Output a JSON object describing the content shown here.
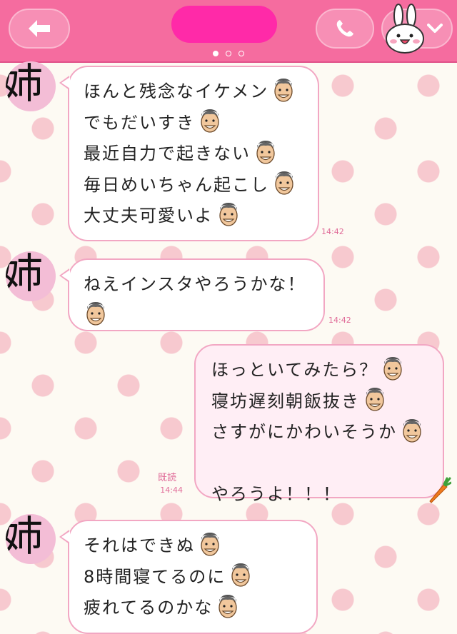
{
  "header": {
    "back_icon": "back-arrow-icon",
    "call_icon": "phone-icon",
    "profile_icon": "bunny-face-icon",
    "dropdown_icon": "chevron-down-icon",
    "page_dots": 3,
    "active_dot": 0,
    "colors": {
      "bar": "#f56c9f",
      "button": "#f78fb5",
      "redaction": "#ff2aa8"
    }
  },
  "messages": [
    {
      "sender": "other",
      "avatar_text": "姉",
      "lines": [
        "ほんと残念なイケメン",
        "でもだいすき",
        "最近自力で起きない",
        "毎日めいちゃん起こし",
        "大丈夫可愛いよ"
      ],
      "time": "14:42"
    },
    {
      "sender": "other",
      "avatar_text": "姉",
      "lines": [
        "ねえインスタやろうかな！",
        ""
      ],
      "time": "14:42"
    },
    {
      "sender": "me",
      "lines": [
        "ほっといてみたら？",
        "寝坊遅刻朝飯抜き",
        "さすがにかわいそうか",
        "",
        "やろうよ！！！"
      ],
      "read_label": "既読",
      "time": "14:44",
      "sticker": "carrot-icon"
    },
    {
      "sender": "other",
      "avatar_text": "姉",
      "lines": [
        "それはできぬ",
        "8時間寝てるのに",
        "疲れてるのかな"
      ],
      "time": ""
    }
  ]
}
